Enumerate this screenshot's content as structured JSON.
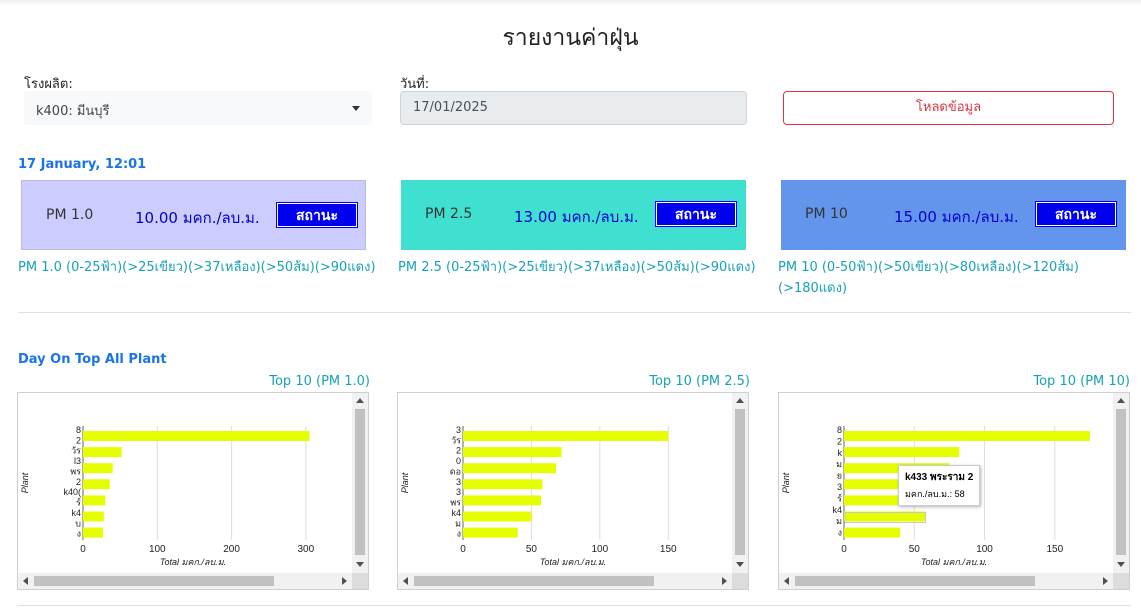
{
  "page": {
    "title": "รายงานค่าฝุ่น"
  },
  "filters": {
    "plant_label": "โรงผลิต:",
    "plant_value": "k400: มีนบุรี",
    "date_label": "วันที่:",
    "date_value": "17/01/2025",
    "load_button": "โหลดข้อมูล"
  },
  "timestamp": "17 January, 12:01",
  "pm_cards": [
    {
      "name": "PM 1.0",
      "value": "10.00 มคก./ลบ.ม.",
      "status": "สถานะ",
      "color": "#ccccff",
      "legend": "PM 1.0 (0-25ฟ้า)(>25เขียว)(>37เหลือง)(>50ส้ม)(>90แดง)"
    },
    {
      "name": "PM 2.5",
      "value": "13.00 มคก./ลบ.ม.",
      "status": "สถานะ",
      "color": "#40e0d0",
      "legend": "PM 2.5 (0-25ฟ้า)(>25เขียว)(>37เหลือง)(>50ส้ม)(>90แดง)"
    },
    {
      "name": "PM 10",
      "value": "15.00 มคก./ลบ.ม.",
      "status": "สถานะ",
      "color": "#6495ed",
      "legend": "PM 10 (0-50ฟ้า)(>50เขียว)(>80เหลือง)(>120ส้ม)",
      "legend2": "(>180แดง)"
    }
  ],
  "section_title": "Day On Top All Plant",
  "bar_color": "#e5ff00",
  "chart_data": [
    {
      "type": "bar",
      "title": "Top 10 (PM 1.0)",
      "orientation": "horizontal",
      "xlabel": "Total มคก./ลบ.ม.",
      "ylabel": "Plant",
      "xlim": [
        0,
        350
      ],
      "xticks": [
        0,
        100,
        200,
        300
      ],
      "categories": [
        "8",
        "2",
        "วัร",
        "l3",
        "พร",
        "2",
        "k40(",
        "ร์",
        "k4",
        "บ",
        "ง"
      ],
      "values": [
        305,
        52,
        40,
        36,
        30,
        28,
        27
      ]
    },
    {
      "type": "bar",
      "title": "Top 10 (PM 2.5)",
      "orientation": "horizontal",
      "xlabel": "Total มคก./ลบ.ม.",
      "ylabel": "Plant",
      "xlim": [
        0,
        190
      ],
      "xticks": [
        0,
        50,
        100,
        150
      ],
      "categories": [
        "3",
        "วัร",
        "2",
        "0",
        "ดอ",
        "3",
        "3",
        "พร",
        "k4",
        "ม",
        "ง"
      ],
      "values": [
        150,
        72,
        68,
        58,
        57,
        50,
        40
      ]
    },
    {
      "type": "bar",
      "title": "Top 10 (PM 10)",
      "orientation": "horizontal",
      "xlabel": "Total มคก./ลบ.ม.",
      "ylabel": "Plant",
      "xlim": [
        0,
        185
      ],
      "xticks": [
        0,
        50,
        100,
        150
      ],
      "categories": [
        "8",
        "2",
        "k",
        "ม",
        "ย",
        "3",
        "ร์",
        "k4",
        "ม",
        "ง"
      ],
      "values": [
        175,
        82,
        75,
        72,
        64,
        58,
        40
      ],
      "tooltip": {
        "plant": "k433 พระราม 2",
        "label": "มคก./ลบ.ม.: 58"
      }
    }
  ]
}
